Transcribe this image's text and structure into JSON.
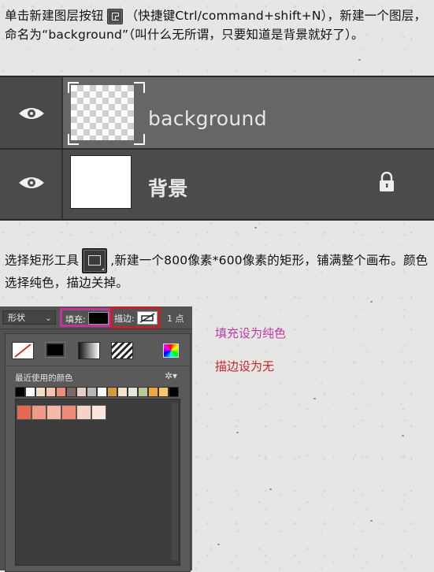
{
  "intro": {
    "part1": "单击新建图层按钮",
    "part2": "（快捷键Ctrl/command+shift+N），新建一个图层，命名为“background”（叫什么无所谓，只要知道是背景就好了）。",
    "icon": "new-layer-icon"
  },
  "layers": [
    {
      "name": "background",
      "visible": true,
      "selected": true,
      "thumbnail": "transparent-checker"
    },
    {
      "name": "背景",
      "visible": true,
      "locked": true,
      "thumbnail": "white"
    }
  ],
  "step2": {
    "part1": "选择矩形工具",
    "part2": ",新建一个800像素*600像素的矩形，铺满整个画布。颜色选择纯色，描边关掉。",
    "icon": "rectangle-tool-icon"
  },
  "options_bar": {
    "mode": "形状",
    "fill_label": "填充:",
    "fill_color": "#000000",
    "stroke_label": "描边:",
    "stroke_value": "none",
    "stroke_width": "1 点",
    "fill_highlight_color": "#c0359c",
    "stroke_highlight_color": "#c4222a"
  },
  "fill_picker": {
    "types": [
      "none",
      "solid",
      "gradient",
      "pattern",
      "color-picker"
    ],
    "selected_type": "solid",
    "recent_label": "最近使用的颜色",
    "recent_colors": [
      "#000000",
      "#ffffff",
      "#f2dcc8",
      "#f5c3b0",
      "#e88e79",
      "#7d6767",
      "#e3cfc4",
      "#b6b6b6",
      "#ffffff",
      "#d29b3c",
      "#f1e4cf",
      "#e8e6dc",
      "#b9c79a",
      "#f0a640",
      "#f5c86b",
      "#000000"
    ],
    "large_swatches": [
      "#e26a4e",
      "#ef9a86",
      "#f5b8a6",
      "#eb8b78",
      "#f6d3c8",
      "#fbe6df"
    ]
  },
  "annotations": {
    "fill": "填充设为纯色",
    "stroke": "描边设为无"
  }
}
